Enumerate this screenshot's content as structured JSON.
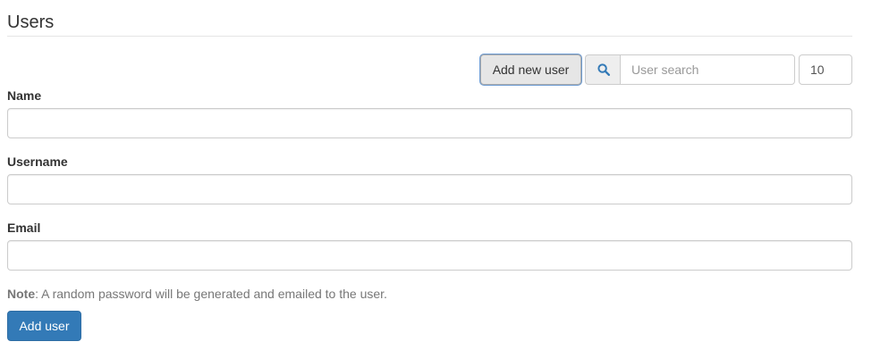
{
  "page": {
    "title": "Users"
  },
  "toolbar": {
    "add_new_user_label": "Add new user",
    "search_icon": "search-icon",
    "search_placeholder": "User search",
    "search_value": "",
    "page_size_value": "10"
  },
  "form": {
    "fields": [
      {
        "label": "Name",
        "value": ""
      },
      {
        "label": "Username",
        "value": ""
      },
      {
        "label": "Email",
        "value": ""
      }
    ],
    "note_prefix": "Note",
    "note_text": ": A random password will be generated and emailed to the user.",
    "submit_label": "Add user"
  },
  "colors": {
    "primary": "#337ab7",
    "search_icon": "#337ab7",
    "focus_ring": "#6c9bd2"
  }
}
